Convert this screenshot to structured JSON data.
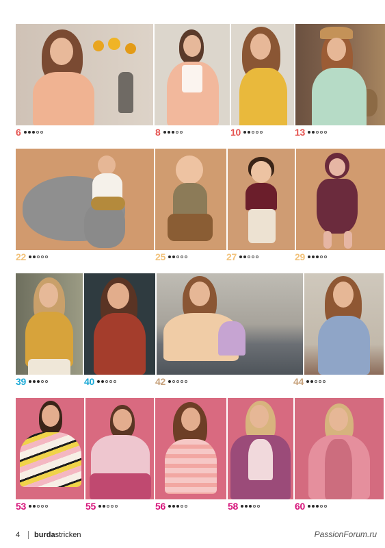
{
  "rows": [
    {
      "items": [
        {
          "page": "6",
          "level": 3,
          "color": "#e55451"
        },
        {
          "page": "8",
          "level": 3,
          "color": "#e55451"
        },
        {
          "page": "10",
          "level": 2,
          "color": "#e55451"
        },
        {
          "page": "13",
          "level": 2,
          "color": "#e55451"
        }
      ]
    },
    {
      "items": [
        {
          "page": "22",
          "level": 2,
          "color": "#f2c27a"
        },
        {
          "page": "25",
          "level": 2,
          "color": "#f2c27a"
        },
        {
          "page": "27",
          "level": 2,
          "color": "#f2c27a"
        },
        {
          "page": "29",
          "level": 3,
          "color": "#f2c27a"
        }
      ]
    },
    {
      "items": [
        {
          "page": "39",
          "level": 3,
          "color": "#1aa9d6"
        },
        {
          "page": "40",
          "level": 2,
          "color": "#1aa9d6"
        },
        {
          "page": "42",
          "level": 1,
          "color": "#c7a27c"
        },
        {
          "page": "44",
          "level": 2,
          "color": "#c7a27c"
        }
      ]
    },
    {
      "items": [
        {
          "page": "53",
          "level": 2,
          "color": "#d6127a"
        },
        {
          "page": "55",
          "level": 2,
          "color": "#d6127a"
        },
        {
          "page": "56",
          "level": 3,
          "color": "#d6127a"
        },
        {
          "page": "58",
          "level": 3,
          "color": "#d6127a"
        },
        {
          "page": "60",
          "level": 3,
          "color": "#d6127a"
        }
      ]
    }
  ],
  "footer": {
    "page_number": "4",
    "brand_bold": "burda",
    "brand_regular": "stricken",
    "watermark": "PassionForum.ru"
  }
}
